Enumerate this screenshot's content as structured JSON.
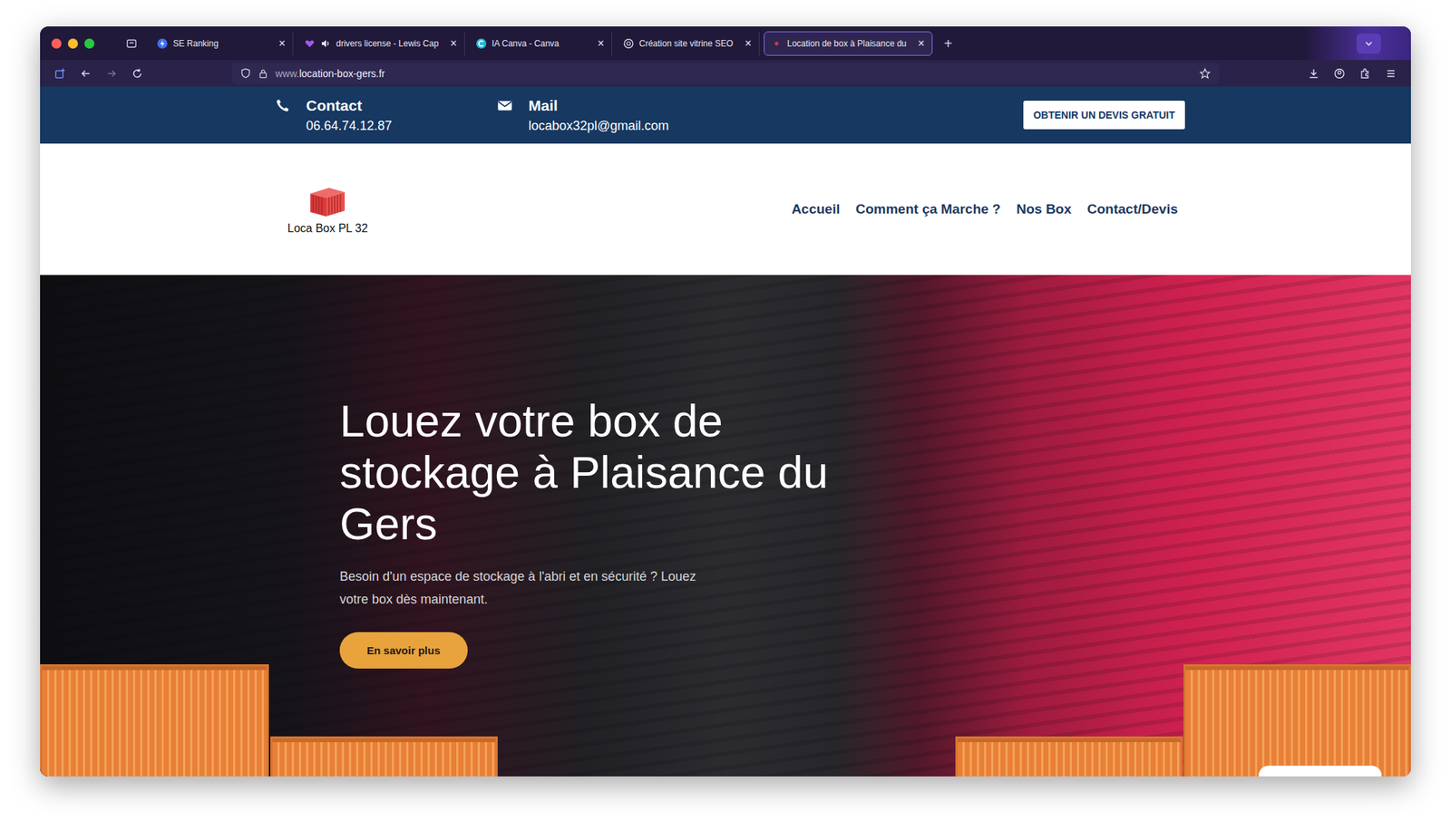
{
  "browser": {
    "tabs": [
      {
        "label": "SE Ranking",
        "selected": false,
        "audio": false,
        "kind": "seranking"
      },
      {
        "label": "drivers license - Lewis Cap",
        "selected": false,
        "audio": true,
        "kind": "heart"
      },
      {
        "label": "IA Canva - Canva",
        "selected": false,
        "audio": false,
        "kind": "canva"
      },
      {
        "label": "Création site vitrine SEO",
        "selected": false,
        "audio": false,
        "kind": "globe"
      },
      {
        "label": "Location de box à Plaisance du",
        "selected": true,
        "audio": false,
        "kind": "dot"
      }
    ],
    "tab_close": "×",
    "new_tab": "+",
    "url": {
      "prefix": "www.",
      "domain": "location-box-gers.fr"
    }
  },
  "site": {
    "topbar": {
      "contacts": [
        {
          "kind": "phone",
          "label": "Contact",
          "value": "06.64.74.12.87"
        },
        {
          "kind": "mail",
          "label": "Mail",
          "value": "locabox32pl@gmail.com"
        }
      ],
      "button": "OBTENIR UN DEVIS GRATUIT"
    },
    "logo": {
      "text": "Loca Box PL 32"
    },
    "nav": [
      {
        "label": "Accueil",
        "selected": false
      },
      {
        "label": "Comment ça Marche ?",
        "selected": false
      },
      {
        "label": "Nos Box",
        "selected": false
      },
      {
        "label": "Contact/Devis",
        "selected": false
      }
    ],
    "hero": {
      "title": "Louez votre box de stockage à Plaisance du Gers",
      "text": "Besoin d'un espace de stockage à l'abri et en sécurité ? Louez votre box dès maintenant.",
      "button": "En savoir plus"
    }
  }
}
